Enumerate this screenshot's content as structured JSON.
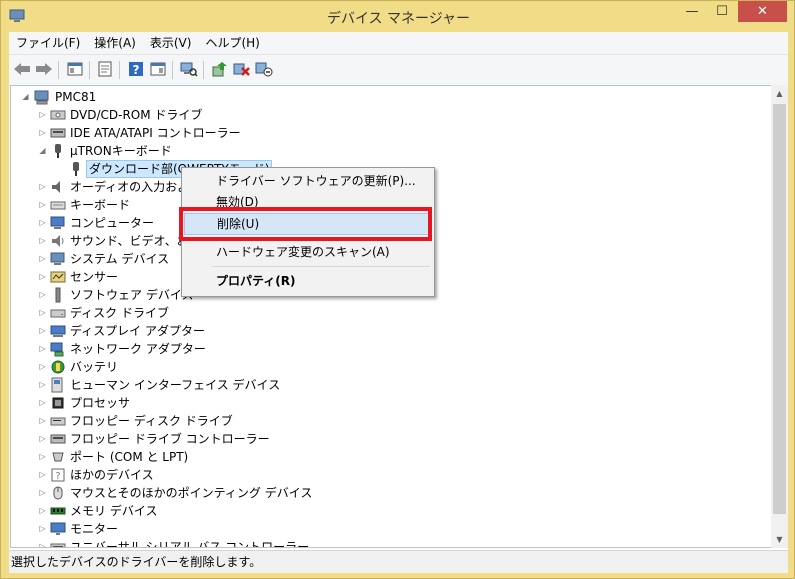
{
  "window": {
    "title": "デバイス マネージャー",
    "min_glyph": "—",
    "max_glyph": "☐",
    "close_glyph": "✕",
    "accent_color": "#f1dc87"
  },
  "menubar": {
    "items": [
      "ファイル(F)",
      "操作(A)",
      "表示(V)",
      "ヘルプ(H)"
    ]
  },
  "toolbar": {
    "icons": [
      "back-icon",
      "forward-icon",
      "show-hide-console-tree-icon",
      "properties-icon",
      "help-icon",
      "action-pane-icon",
      "scan-hardware-icon",
      "update-driver-icon",
      "uninstall-icon",
      "disable-device-icon"
    ]
  },
  "tree": {
    "root": "PMC81",
    "items": [
      {
        "label": "DVD/CD-ROM ドライブ",
        "icon": "dvd-icon",
        "expanded": false
      },
      {
        "label": "IDE ATA/ATAPI コントローラー",
        "icon": "ide-controller-icon",
        "expanded": false
      },
      {
        "label": "µTRONキーボード",
        "icon": "keyboard-plug-icon",
        "expanded": true
      },
      {
        "label": "ダウンロード部(QWERTYモード)",
        "icon": "keyboard-plug-icon",
        "child": true,
        "selected": true
      },
      {
        "label": "オーディオの入力および出力",
        "icon": "speaker-icon",
        "expanded": false
      },
      {
        "label": "キーボード",
        "icon": "keyboard-icon",
        "expanded": false
      },
      {
        "label": "コンピューター",
        "icon": "computer-icon",
        "expanded": false
      },
      {
        "label": "サウンド、ビデオ、およびゲーム コントローラー",
        "icon": "sound-icon",
        "expanded": false
      },
      {
        "label": "システム デバイス",
        "icon": "system-device-icon",
        "expanded": false
      },
      {
        "label": "センサー",
        "icon": "sensor-icon",
        "expanded": false
      },
      {
        "label": "ソフトウェア デバイス",
        "icon": "software-device-icon",
        "expanded": false
      },
      {
        "label": "ディスク ドライブ",
        "icon": "disk-drive-icon",
        "expanded": false
      },
      {
        "label": "ディスプレイ アダプター",
        "icon": "display-adapter-icon",
        "expanded": false
      },
      {
        "label": "ネットワーク アダプター",
        "icon": "network-adapter-icon",
        "expanded": false
      },
      {
        "label": "バッテリ",
        "icon": "battery-icon",
        "expanded": false
      },
      {
        "label": "ヒューマン インターフェイス デバイス",
        "icon": "hid-icon",
        "expanded": false
      },
      {
        "label": "プロセッサ",
        "icon": "processor-icon",
        "expanded": false
      },
      {
        "label": "フロッピー ディスク ドライブ",
        "icon": "floppy-drive-icon",
        "expanded": false
      },
      {
        "label": "フロッピー ドライブ コントローラー",
        "icon": "floppy-controller-icon",
        "expanded": false
      },
      {
        "label": "ポート (COM と LPT)",
        "icon": "port-icon",
        "expanded": false
      },
      {
        "label": "ほかのデバイス",
        "icon": "other-device-icon",
        "expanded": false
      },
      {
        "label": "マウスとそのほかのポインティング デバイス",
        "icon": "mouse-icon",
        "expanded": false
      },
      {
        "label": "メモリ デバイス",
        "icon": "memory-icon",
        "expanded": false
      },
      {
        "label": "モニター",
        "icon": "monitor-icon",
        "expanded": false
      },
      {
        "label": "ユニバーサル シリアル バス コントローラー",
        "icon": "usb-icon",
        "expanded": false
      }
    ]
  },
  "context_menu": {
    "items": [
      {
        "label": "ドライバー ソフトウェアの更新(P)..."
      },
      {
        "label": "無効(D)"
      },
      {
        "label": "削除(U)",
        "highlighted": true
      },
      {
        "label": "ハードウェア変更のスキャン(A)"
      },
      {
        "label": "プロパティ(R)",
        "bold": true
      }
    ]
  },
  "status": {
    "text": "選択したデバイスのドライバーを削除します。"
  },
  "scrollbar": {
    "up_glyph": "▲",
    "down_glyph": "▼"
  },
  "tree_glyphs": {
    "collapsed": "▷",
    "expanded": "◢"
  }
}
